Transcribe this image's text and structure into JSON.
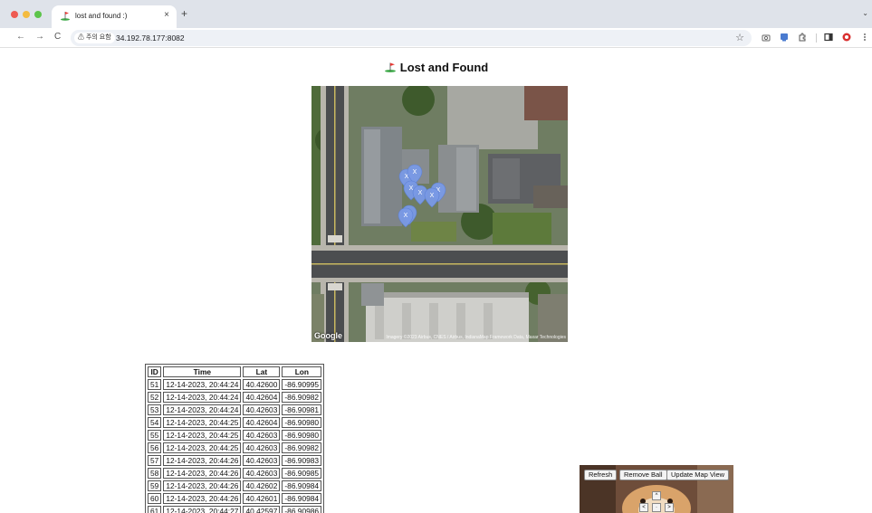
{
  "browser": {
    "tab_title": "lost and found :)",
    "tab_close": "×",
    "new_tab": "+",
    "tab_menu": "⌄",
    "back": "←",
    "forward": "→",
    "reload": "C",
    "security_label": "⚠ 주의 요함",
    "url": "34.192.78.177:8082",
    "bookmark": "☆"
  },
  "page": {
    "title": "Lost and Found"
  },
  "map": {
    "google_label": "Google",
    "attribution": "Imagery ©2023 Airbus, CNES / Airbus, IndianaMap Framework Data, Maxar Technologies",
    "marker_label": "X"
  },
  "table": {
    "headers": [
      "ID",
      "Time",
      "Lat",
      "Lon"
    ],
    "rows": [
      [
        "51",
        "12-14-2023, 20:44:24",
        "40.42600",
        "-86.90995"
      ],
      [
        "52",
        "12-14-2023, 20:44:24",
        "40.42604",
        "-86.90982"
      ],
      [
        "53",
        "12-14-2023, 20:44:24",
        "40.42603",
        "-86.90981"
      ],
      [
        "54",
        "12-14-2023, 20:44:25",
        "40.42604",
        "-86.90980"
      ],
      [
        "55",
        "12-14-2023, 20:44:25",
        "40.42603",
        "-86.90980"
      ],
      [
        "56",
        "12-14-2023, 20:44:25",
        "40.42603",
        "-86.90982"
      ],
      [
        "57",
        "12-14-2023, 20:44:26",
        "40.42603",
        "-86.90983"
      ],
      [
        "58",
        "12-14-2023, 20:44:26",
        "40.42603",
        "-86.90985"
      ],
      [
        "59",
        "12-14-2023, 20:44:26",
        "40.42602",
        "-86.90984"
      ],
      [
        "60",
        "12-14-2023, 20:44:26",
        "40.42601",
        "-86.90984"
      ],
      [
        "61",
        "12-14-2023, 20:44:27",
        "40.42597",
        "-86.90986"
      ]
    ]
  },
  "controls": {
    "refresh": "Refresh",
    "remove_ball": "Remove Ball",
    "update_map_view": "Update Map View",
    "up": "^",
    "left": "<",
    "center": "·",
    "right": ">"
  }
}
